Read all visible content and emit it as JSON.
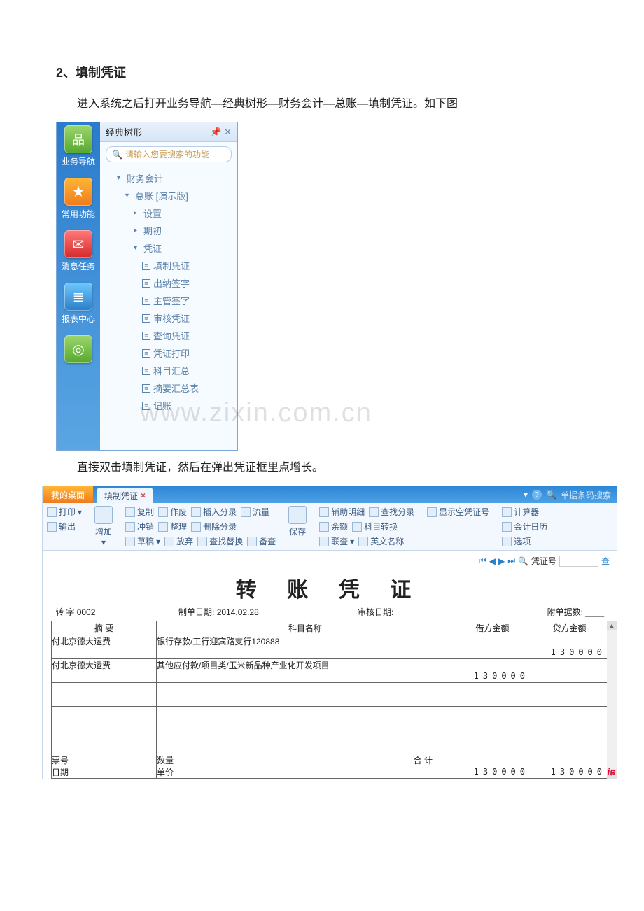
{
  "doc": {
    "heading": "2、填制凭证",
    "intro": "进入系统之后打开业务导航—经典树形—财务会计—总账—填制凭证。如下图",
    "intro2": "直接双击填制凭证，然后在弹出凭证框里点增长。",
    "watermark": "www.zixin.com.cn"
  },
  "shot1": {
    "panel_title": "经典树形",
    "search_placeholder": "请输入您要搜索的功能",
    "side": {
      "nav": "业务导航",
      "fav": "常用功能",
      "msg": "消息任务",
      "rpt": "报表中心",
      "cmp": ""
    },
    "tree": {
      "root": "财务会计",
      "ledger": "总账 [演示版]",
      "setup": "设置",
      "period": "期初",
      "voucher": "凭证",
      "items": {
        "0": "填制凭证",
        "1": "出纳签字",
        "2": "主管签字",
        "3": "审核凭证",
        "4": "查询凭证",
        "5": "凭证打印",
        "6": "科目汇总",
        "7": "摘要汇总表",
        "8": "记账"
      }
    }
  },
  "shot2": {
    "tabs": {
      "home": "我的桌面",
      "open": "填制凭证",
      "search_ph": "单据条码搜索",
      "search_link": "查"
    },
    "toolbar": {
      "print": "打印",
      "export": "输出",
      "add": "增加",
      "copy": "复制",
      "offset": "冲销",
      "draft": "草稿",
      "void": "作废",
      "tidy": "整理",
      "abort": "放弃",
      "insline": "插入分录",
      "delline": "删除分录",
      "findrep": "查找替换",
      "flow": "流量",
      "backup": "备查",
      "save": "保存",
      "aux": "辅助明细",
      "balance": "余额",
      "linkchk": "联查",
      "findent": "查找分录",
      "subjconv": "科目转换",
      "enname": "英文名称",
      "showempty": "显示空凭证号",
      "calc": "计算器",
      "calendar": "会计日历",
      "options": "选项",
      "vnum_lbl": "凭证号"
    },
    "voucher": {
      "title": "转 账 凭 证",
      "word_lbl": "转        字",
      "word_no": "0002",
      "make_date_lbl": "制单日期:",
      "make_date": "2014.02.28",
      "audit_date_lbl": "审核日期:",
      "attach_lbl": "附单据数:",
      "cols": {
        "summary": "摘 要",
        "subject": "科目名称",
        "debit": "借方金额",
        "credit": "贷方金额"
      },
      "rows": [
        {
          "summary": "付北京德大运费",
          "subject": "银行存款/工行迎宾路支行120888",
          "debit": "",
          "credit": "130000"
        },
        {
          "summary": "付北京德大运费",
          "subject": "其他应付款/项目类/玉米新品种产业化开发项目",
          "debit": "130000",
          "credit": ""
        },
        {
          "summary": "",
          "subject": "",
          "debit": "",
          "credit": ""
        },
        {
          "summary": "",
          "subject": "",
          "debit": "",
          "credit": ""
        },
        {
          "summary": "",
          "subject": "",
          "debit": "",
          "credit": ""
        }
      ],
      "foot": {
        "billno": "票号",
        "date": "日期",
        "qty": "数量",
        "price": "单价",
        "total": "合 计",
        "total_debit": "130000",
        "total_credit": "130000"
      },
      "badge": "is"
    }
  }
}
